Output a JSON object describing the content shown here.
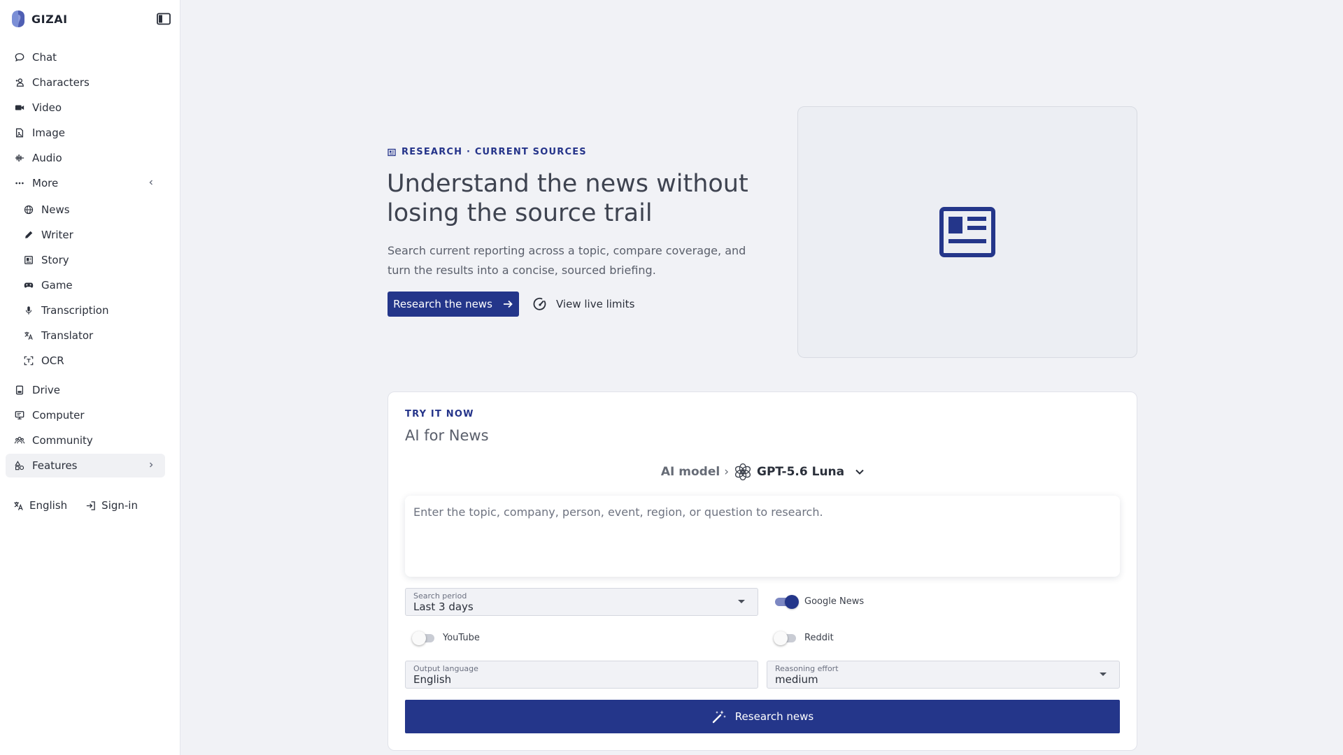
{
  "brand": {
    "name": "GIZAI",
    "logo_icon": "gizai-logo-icon",
    "accent": "#24368a"
  },
  "sidebar": {
    "toggle_icon": "sidebar-toggle-icon",
    "items": [
      {
        "label": "Chat",
        "icon": "chat-bubble-icon"
      },
      {
        "label": "Characters",
        "icon": "characters-icon"
      },
      {
        "label": "Video",
        "icon": "video-camera-icon"
      },
      {
        "label": "Image",
        "icon": "image-icon"
      },
      {
        "label": "Audio",
        "icon": "audio-wave-icon"
      },
      {
        "label": "More",
        "icon": "ellipsis-icon",
        "expanded": true
      }
    ],
    "sub_items": [
      {
        "label": "News",
        "icon": "globe-icon"
      },
      {
        "label": "Writer",
        "icon": "pen-icon"
      },
      {
        "label": "Story",
        "icon": "book-icon"
      },
      {
        "label": "Game",
        "icon": "gamepad-icon"
      },
      {
        "label": "Transcription",
        "icon": "microphone-icon"
      },
      {
        "label": "Translator",
        "icon": "translate-icon"
      },
      {
        "label": "OCR",
        "icon": "scan-text-icon"
      }
    ],
    "bottom_items": [
      {
        "label": "Drive",
        "icon": "drive-icon"
      },
      {
        "label": "Computer",
        "icon": "computer-icon"
      },
      {
        "label": "Community",
        "icon": "community-icon"
      },
      {
        "label": "Features",
        "icon": "shapes-icon",
        "active": true
      }
    ],
    "footer": {
      "language": "English",
      "signin": "Sign-in"
    }
  },
  "hero": {
    "eyebrow": "RESEARCH · CURRENT SOURCES",
    "title": "Understand the news without losing the source trail",
    "description": "Search current reporting across a topic, compare coverage, and turn the results into a concise, sourced briefing.",
    "primary_button": "Research the news",
    "secondary_link": "View live limits",
    "media_icon": "newspaper-icon"
  },
  "tool": {
    "eyebrow": "TRY IT NOW",
    "title": "AI for News",
    "model_label": "AI model",
    "model_separator": "›",
    "model_name": "GPT-5.6 Luna",
    "prompt_placeholder": "Enter the topic, company, person, event, region, or question to research.",
    "prompt_value": "",
    "search_period": {
      "label": "Search period",
      "value": "Last 3 days"
    },
    "toggles": [
      {
        "label": "Google News",
        "on": true
      },
      {
        "label": "YouTube",
        "on": false
      },
      {
        "label": "Reddit",
        "on": false
      }
    ],
    "output_language": {
      "label": "Output language",
      "value": "English"
    },
    "reasoning_effort": {
      "label": "Reasoning effort",
      "value": "medium"
    },
    "submit": "Research news"
  }
}
